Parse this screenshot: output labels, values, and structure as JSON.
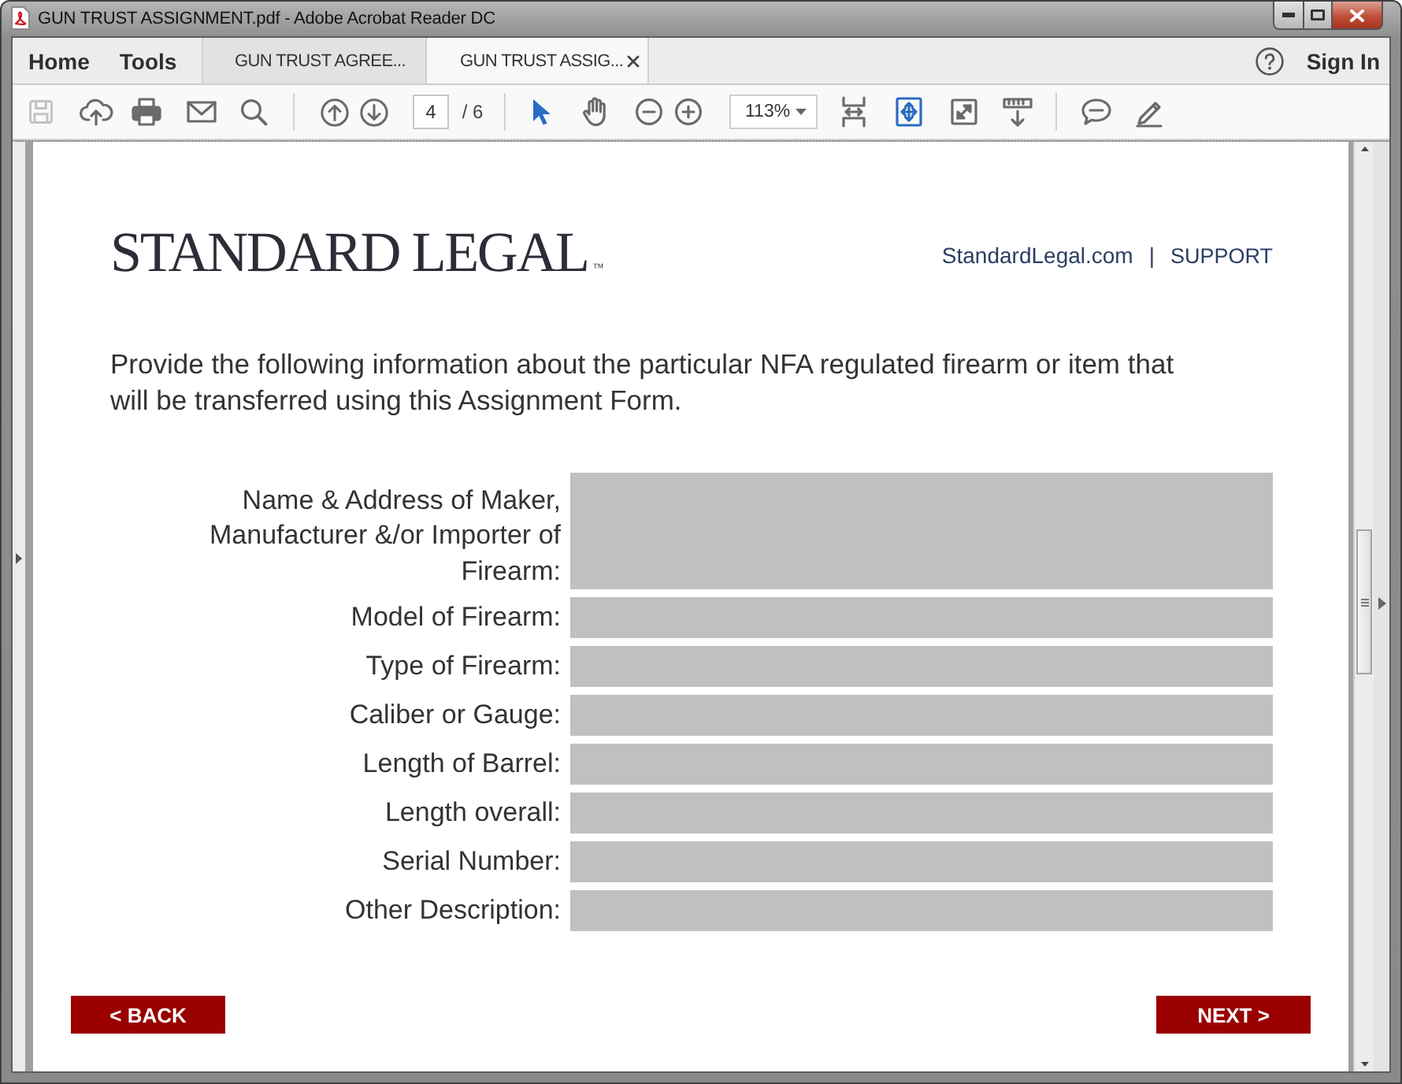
{
  "window": {
    "title": "GUN TRUST ASSIGNMENT.pdf - Adobe Acrobat Reader DC"
  },
  "nav": [
    {
      "label": "Home"
    },
    {
      "label": "Tools"
    }
  ],
  "tabs": [
    {
      "label": "GUN TRUST AGREE...",
      "selected": false
    },
    {
      "label": "GUN TRUST ASSIG...",
      "selected": true
    }
  ],
  "account": {
    "label": "Sign In"
  },
  "toolbar": {
    "save": {
      "disabled": true
    },
    "page_number": "4",
    "page_count": "/ 6",
    "tools": [
      {
        "selected": true
      },
      {
        "selected": false
      }
    ],
    "zoom": "113%",
    "view_modes": [
      {
        "selected": false
      },
      {
        "selected": true
      }
    ]
  },
  "page": {
    "logo": {
      "text": "STANDARD LEGAL",
      "mark": "™"
    },
    "links": [
      {
        "label": "StandardLegal.com"
      },
      {
        "label": "SUPPORT"
      }
    ],
    "link_separator": "|",
    "intro": "Provide the following information about the particular NFA regulated firearm or item that\nwill be transferred using this Assignment Form.",
    "fields": [
      {
        "label": "Name & Address of Maker,\nManufacturer &/or Importer of\nFirearm:",
        "kind": "multiline"
      },
      {
        "label": "Model of Firearm:",
        "kind": "line"
      },
      {
        "label": "Type of Firearm:",
        "kind": "line"
      },
      {
        "label": "Caliber or Gauge:",
        "kind": "line"
      },
      {
        "label": "Length of Barrel:",
        "kind": "line"
      },
      {
        "label": "Length overall:",
        "kind": "line"
      },
      {
        "label": "Serial Number:",
        "kind": "line"
      },
      {
        "label": "Other Description:",
        "kind": "line"
      }
    ],
    "buttons": [
      {
        "label": "< BACK"
      },
      {
        "label": "NEXT >"
      }
    ]
  }
}
